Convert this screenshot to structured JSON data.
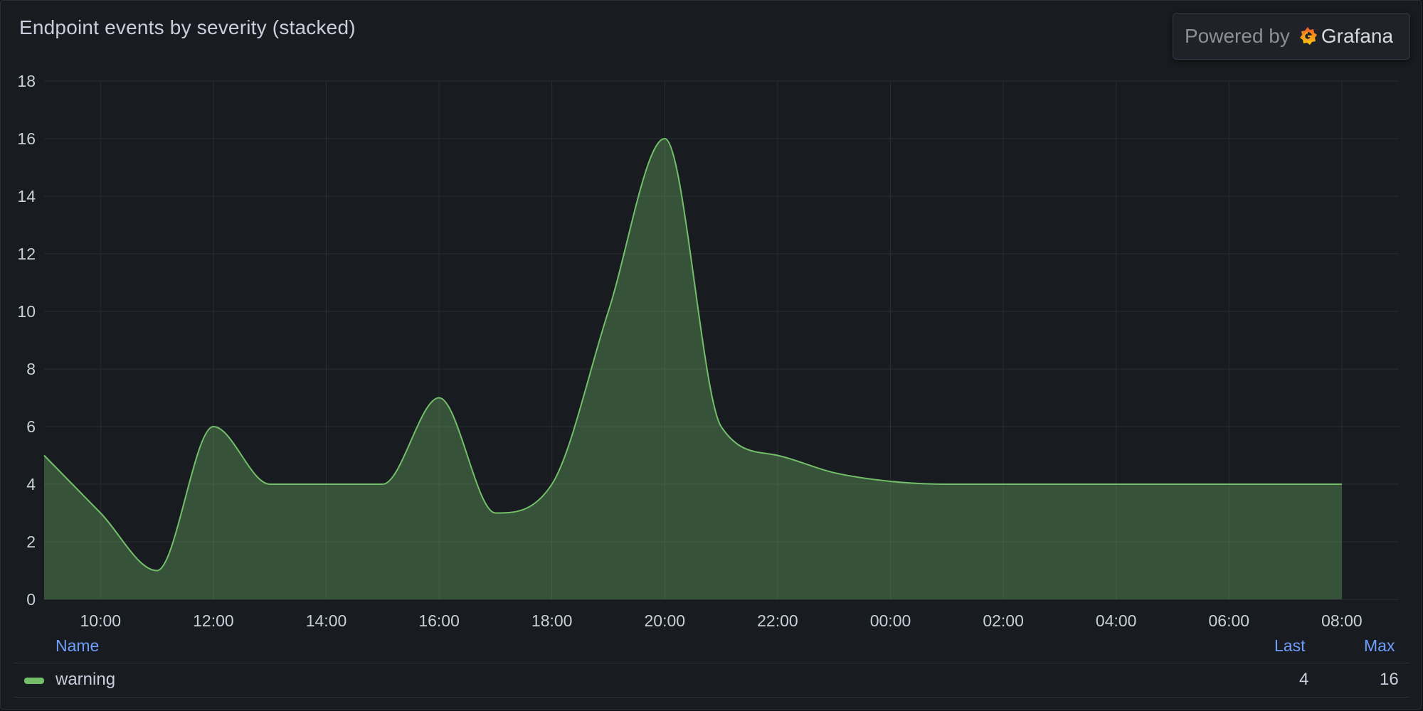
{
  "panel": {
    "title": "Endpoint events by severity (stacked)"
  },
  "badge": {
    "powered_label": "Powered by",
    "brand": "Grafana",
    "logo_icon": "grafana-logo-icon"
  },
  "chart_data": {
    "type": "area",
    "stacked": true,
    "x_tick_labels": [
      "10:00",
      "12:00",
      "14:00",
      "16:00",
      "18:00",
      "20:00",
      "22:00",
      "00:00",
      "02:00",
      "04:00",
      "06:00",
      "08:00"
    ],
    "y_tick_labels": [
      "0",
      "2",
      "4",
      "6",
      "8",
      "10",
      "12",
      "14",
      "16",
      "18"
    ],
    "ylim": [
      0,
      18
    ],
    "x_range_hours": [
      "09:00",
      "08:00 (+1 day)"
    ],
    "grid": true,
    "series": [
      {
        "name": "warning",
        "color": "#73bf69",
        "x": [
          "09:00",
          "10:00",
          "11:00",
          "12:00",
          "13:00",
          "14:00",
          "15:00",
          "16:00",
          "17:00",
          "18:00",
          "19:00",
          "20:00",
          "21:00",
          "22:00",
          "23:00",
          "00:00",
          "01:00",
          "02:00",
          "03:00",
          "04:00",
          "05:00",
          "06:00",
          "07:00",
          "08:00"
        ],
        "values": [
          5,
          3,
          1,
          6,
          4,
          4,
          4,
          7,
          3,
          4,
          10,
          16,
          6,
          5,
          4.4,
          4.1,
          4,
          4,
          4,
          4,
          4,
          4,
          4,
          4
        ]
      }
    ]
  },
  "legend": {
    "headers": {
      "name": "Name",
      "last": "Last",
      "max": "Max"
    },
    "rows": [
      {
        "name": "warning",
        "last": "4",
        "max": "16",
        "color": "#73bf69"
      }
    ]
  }
}
